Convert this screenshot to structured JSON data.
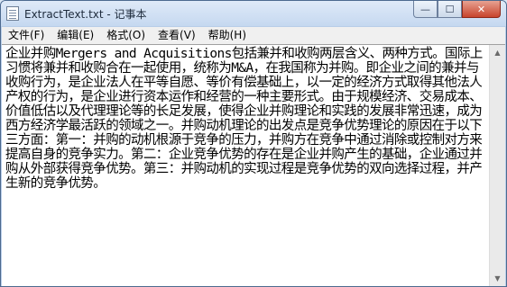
{
  "window": {
    "title": "ExtractText.txt - 记事本",
    "icon": "notepad-icon",
    "minimize_glyph": "—",
    "maximize_glyph": "☐",
    "close_glyph": "✕"
  },
  "menu": {
    "file": "文件(F)",
    "edit": "编辑(E)",
    "format": "格式(O)",
    "view": "查看(V)",
    "help": "帮助(H)"
  },
  "editor": {
    "content": "企业并购Mergers and Acquisitions包括兼并和收购两层含义、两种方式。国际上习惯将兼并和收购合在一起使用，统称为M&A，在我国称为并购。即企业之间的兼并与收购行为，是企业法人在平等自愿、等价有偿基础上，以一定的经济方式取得其他法人产权的行为，是企业进行资本运作和经营的一种主要形式。由于规模经济、交易成本、价值低估以及代理理论等的长足发展，使得企业并购理论和实践的发展非常迅速，成为西方经济学最活跃的领域之一。并购动机理论的出发点是竞争优势理论的原因在于以下三方面：第一：并购的动机根源于竞争的压力，并购方在竞争中通过消除或控制对方来提高自身的竞争实力。第二：企业竞争优势的存在是企业并购产生的基础，企业通过并购从外部获得竞争优势。第三：并购动机的实现过程是竞争优势的双向选择过程，并产生新的竞争优势。"
  },
  "scrollbar": {
    "up_glyph": "▲",
    "down_glyph": "▼"
  }
}
